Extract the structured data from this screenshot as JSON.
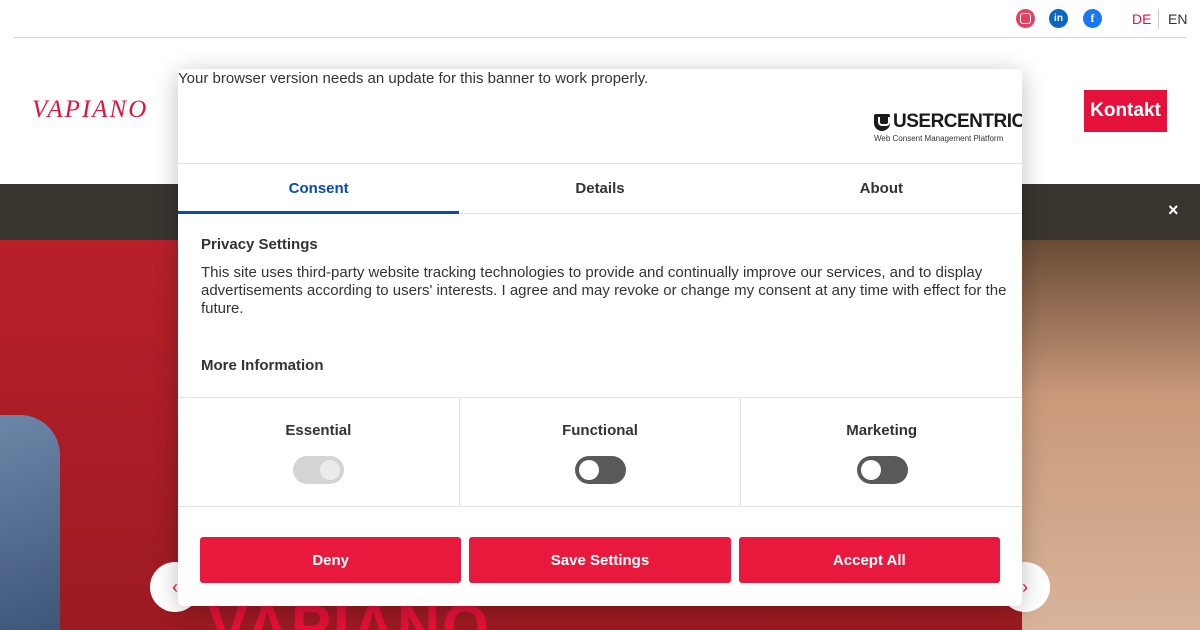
{
  "site": {
    "social": {
      "instagram": "",
      "linkedin": "in",
      "facebook": "f"
    },
    "lang": {
      "de": "DE",
      "en": "EN"
    },
    "logo": "VAPIANO",
    "kontakt": "Kontakt",
    "close": "×",
    "hero_text": "VAPIANO",
    "arrow_left": "‹",
    "arrow_right": "›"
  },
  "colors": {
    "brand_red": "#e4113a",
    "tab_active_blue": "#0a4bab",
    "button_red": "#e8193c"
  },
  "modal": {
    "browser_warning": "Your browser version needs an update for this banner to work properly.",
    "provider": {
      "brand": "USERCENTRICS",
      "subtitle": "Web Consent Management Platform"
    },
    "tabs": [
      {
        "label": "Consent",
        "active": true
      },
      {
        "label": "Details",
        "active": false
      },
      {
        "label": "About",
        "active": false
      }
    ],
    "privacy_title": "Privacy Settings",
    "privacy_text": "This site uses third-party website tracking technologies to provide and continually improve our services, and to display advertisements according to users' interests. I agree and may revoke or change my consent at any time with effect for the future.",
    "more_info": "More Information",
    "categories": [
      {
        "label": "Essential",
        "enabled": true,
        "locked": true
      },
      {
        "label": "Functional",
        "enabled": false,
        "locked": false
      },
      {
        "label": "Marketing",
        "enabled": false,
        "locked": false
      }
    ],
    "buttons": {
      "deny": "Deny",
      "save": "Save Settings",
      "accept": "Accept All"
    }
  }
}
